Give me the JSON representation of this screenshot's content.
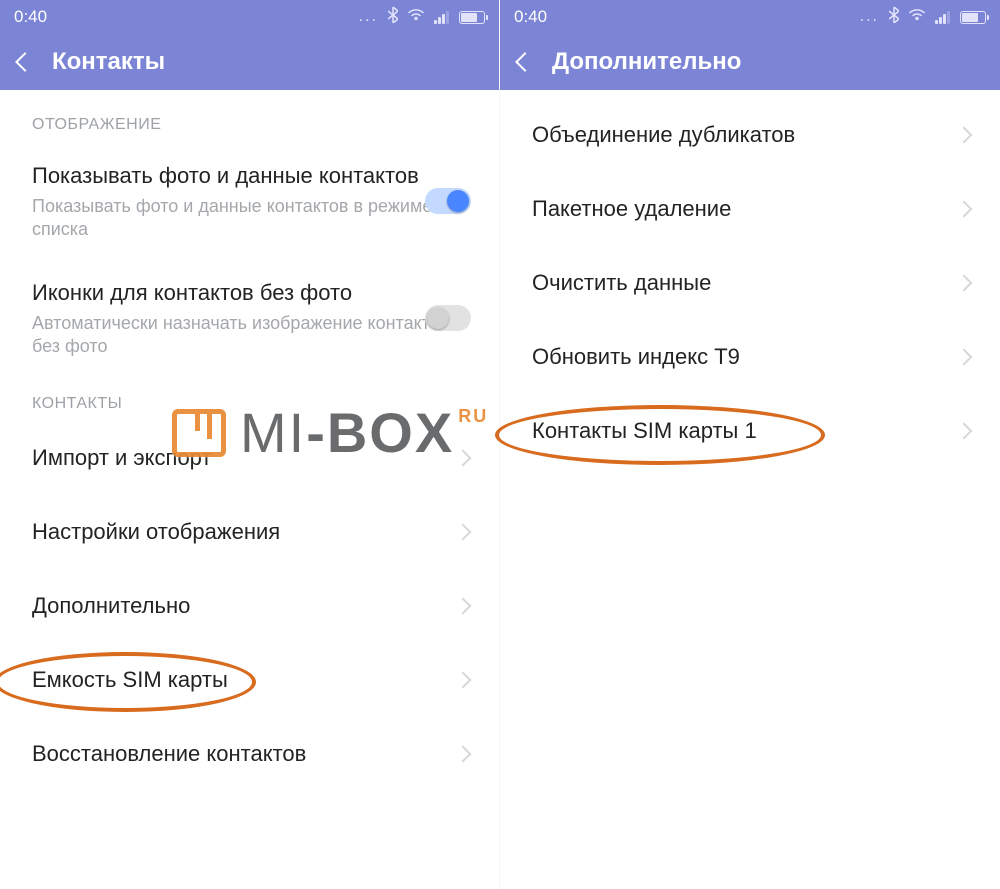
{
  "statusbar": {
    "time": "0:40"
  },
  "watermark": {
    "text1": "MI",
    "text2": "-BOX",
    "ru": "RU"
  },
  "left": {
    "title": "Контакты",
    "section_display": "ОТОБРАЖЕНИЕ",
    "row_photo_title": "Показывать фото и данные контактов",
    "row_photo_sub": "Показывать фото и данные контактов в режиме списка",
    "row_icons_title": "Иконки для контактов без фото",
    "row_icons_sub": "Автоматически назначать изображение контактам без фото",
    "section_contacts": "КОНТАКТЫ",
    "row_import": "Импорт и экспорт",
    "row_view": "Настройки отображения",
    "row_more": "Дополнительно",
    "row_sim": "Емкость SIM карты",
    "row_restore": "Восстановление контактов"
  },
  "right": {
    "title": "Дополнительно",
    "row_merge": "Объединение дубликатов",
    "row_batch": "Пакетное удаление",
    "row_clear": "Очистить данные",
    "row_t9": "Обновить индекс T9",
    "row_sim1": "Контакты SIM карты 1"
  }
}
